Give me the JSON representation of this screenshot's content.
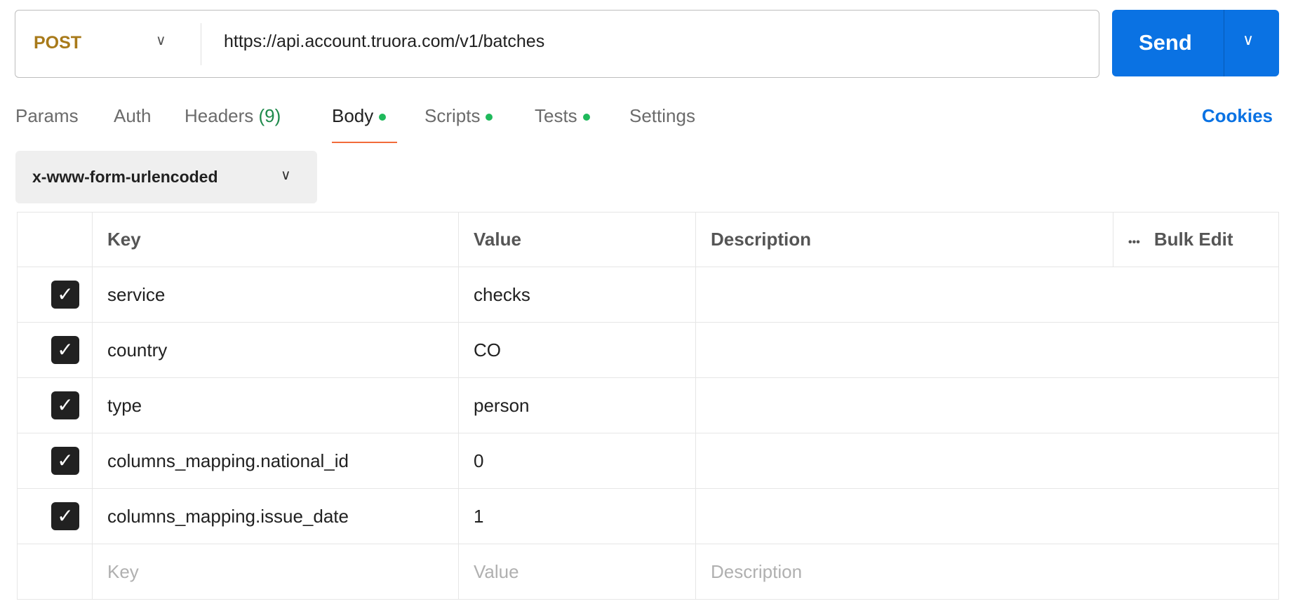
{
  "request": {
    "method": "POST",
    "url": "https://api.account.truora.com/v1/batches",
    "send_label": "Send"
  },
  "tabs": [
    {
      "label": "Params"
    },
    {
      "label": "Auth"
    },
    {
      "label": "Headers",
      "count": "(9)"
    },
    {
      "label": "Body",
      "dot": true
    },
    {
      "label": "Scripts",
      "dot": true
    },
    {
      "label": "Tests",
      "dot": true
    },
    {
      "label": "Settings"
    }
  ],
  "active_tab": "Body",
  "cookies_label": "Cookies",
  "body_type": "x-www-form-urlencoded",
  "table": {
    "headers": {
      "key": "Key",
      "value": "Value",
      "description": "Description",
      "more": "•••",
      "bulk_edit": "Bulk Edit"
    },
    "rows": [
      {
        "checked": true,
        "key": "service",
        "value": "checks",
        "description": ""
      },
      {
        "checked": true,
        "key": "country",
        "value": "CO",
        "description": ""
      },
      {
        "checked": true,
        "key": "type",
        "value": "person",
        "description": ""
      },
      {
        "checked": true,
        "key": "columns_mapping.national_id",
        "value": "0",
        "description": ""
      },
      {
        "checked": true,
        "key": "columns_mapping.issue_date",
        "value": "1",
        "description": ""
      }
    ],
    "placeholders": {
      "key": "Key",
      "value": "Value",
      "description": "Description"
    }
  },
  "colors": {
    "accent": "#0a72e3",
    "method": "#a87a1a",
    "active_underline": "#f26b3a",
    "dot": "#1fb95b"
  }
}
